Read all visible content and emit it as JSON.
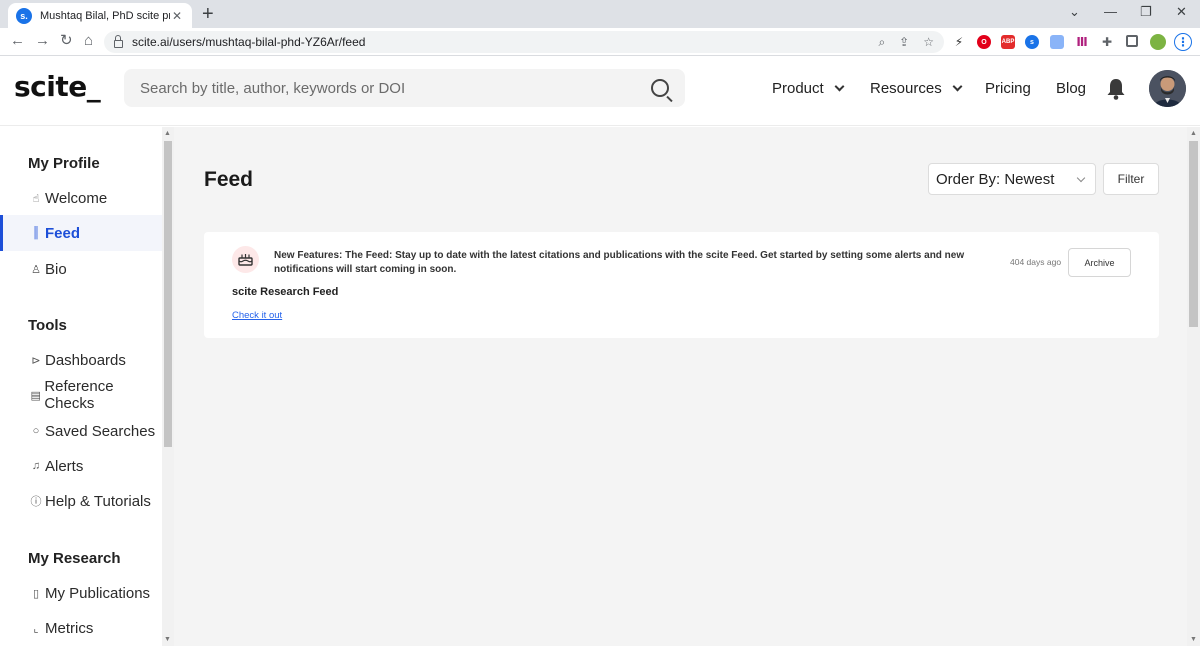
{
  "browser": {
    "tab_title": "Mushtaq Bilal, PhD scite profile",
    "tab_favicon": "s.",
    "url": "scite.ai/users/mushtaq-bilal-phd-YZ6Ar/feed",
    "new_tab": "+",
    "close": "✕"
  },
  "header": {
    "logo": "scite_",
    "search_placeholder": "Search by title, author, keywords or DOI",
    "nav": {
      "product": "Product",
      "resources": "Resources",
      "pricing": "Pricing",
      "blog": "Blog"
    }
  },
  "sidebar": {
    "sections": [
      {
        "heading": "My Profile"
      },
      {
        "heading": "Tools"
      },
      {
        "heading": "My Research"
      }
    ],
    "items": [
      {
        "label": "Welcome",
        "icon": "hand-wave-icon",
        "glyph": "☝"
      },
      {
        "label": "Feed",
        "icon": "feed-wave-icon",
        "glyph": "║",
        "active": true
      },
      {
        "label": "Bio",
        "icon": "person-icon",
        "glyph": "♙"
      },
      {
        "label": "Dashboards",
        "icon": "dashboard-icon",
        "glyph": "⊳"
      },
      {
        "label": "Reference Checks",
        "icon": "document-icon",
        "glyph": "▤"
      },
      {
        "label": "Saved Searches",
        "icon": "search-icon",
        "glyph": "○"
      },
      {
        "label": "Alerts",
        "icon": "bell-icon",
        "glyph": "♫"
      },
      {
        "label": "Help & Tutorials",
        "icon": "info-icon",
        "glyph": "ⓘ"
      },
      {
        "label": "My Publications",
        "icon": "book-icon",
        "glyph": "▯"
      },
      {
        "label": "Metrics",
        "icon": "chart-icon",
        "glyph": "⌞"
      }
    ]
  },
  "main": {
    "title": "Feed",
    "order_by": "Order By: Newest",
    "filter_label": "Filter",
    "feed": [
      {
        "text": "New Features: The Feed: Stay up to date with the latest citations and publications with the scite Feed. Get started by setting some alerts and new notifications will start coming in soon.",
        "time": "404 days ago",
        "archive_label": "Archive",
        "title": "scite Research Feed",
        "link_label": "Check it out"
      }
    ]
  },
  "colors": {
    "accent": "#1d4fd8",
    "feed_icon_bg": "#fde8e8",
    "main_bg": "#f4f4f4"
  }
}
